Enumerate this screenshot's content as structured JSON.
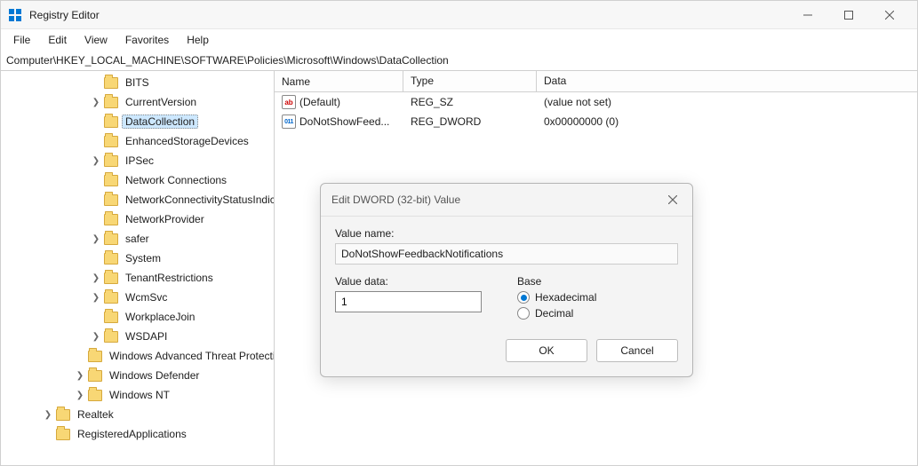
{
  "window": {
    "title": "Registry Editor"
  },
  "menu": {
    "file": "File",
    "edit": "Edit",
    "view": "View",
    "favorites": "Favorites",
    "help": "Help"
  },
  "address": "Computer\\HKEY_LOCAL_MACHINE\\SOFTWARE\\Policies\\Microsoft\\Windows\\DataCollection",
  "tree": [
    {
      "label": "BITS",
      "indent": 100,
      "twisty": ""
    },
    {
      "label": "CurrentVersion",
      "indent": 100,
      "twisty": ">"
    },
    {
      "label": "DataCollection",
      "indent": 100,
      "twisty": "",
      "selected": true
    },
    {
      "label": "EnhancedStorageDevices",
      "indent": 100,
      "twisty": ""
    },
    {
      "label": "IPSec",
      "indent": 100,
      "twisty": ">"
    },
    {
      "label": "Network Connections",
      "indent": 100,
      "twisty": ""
    },
    {
      "label": "NetworkConnectivityStatusIndicator",
      "indent": 100,
      "twisty": ""
    },
    {
      "label": "NetworkProvider",
      "indent": 100,
      "twisty": ""
    },
    {
      "label": "safer",
      "indent": 100,
      "twisty": ">"
    },
    {
      "label": "System",
      "indent": 100,
      "twisty": ""
    },
    {
      "label": "TenantRestrictions",
      "indent": 100,
      "twisty": ">"
    },
    {
      "label": "WcmSvc",
      "indent": 100,
      "twisty": ">"
    },
    {
      "label": "WorkplaceJoin",
      "indent": 100,
      "twisty": ""
    },
    {
      "label": "WSDAPI",
      "indent": 100,
      "twisty": ">"
    },
    {
      "label": "Windows Advanced Threat Protection",
      "indent": 82,
      "twisty": ""
    },
    {
      "label": "Windows Defender",
      "indent": 82,
      "twisty": ">"
    },
    {
      "label": "Windows NT",
      "indent": 82,
      "twisty": ">"
    },
    {
      "label": "Realtek",
      "indent": 46,
      "twisty": ">"
    },
    {
      "label": "RegisteredApplications",
      "indent": 46,
      "twisty": ""
    }
  ],
  "list": {
    "headers": {
      "name": "Name",
      "type": "Type",
      "data": "Data"
    },
    "rows": [
      {
        "icon": "sz",
        "name": "(Default)",
        "type": "REG_SZ",
        "data": "(value not set)"
      },
      {
        "icon": "dw",
        "name": "DoNotShowFeed...",
        "type": "REG_DWORD",
        "data": "0x00000000 (0)"
      }
    ]
  },
  "dialog": {
    "title": "Edit DWORD (32-bit) Value",
    "value_name_label": "Value name:",
    "value_name": "DoNotShowFeedbackNotifications",
    "value_data_label": "Value data:",
    "value_data": "1",
    "base_label": "Base",
    "hex_label": "Hexadecimal",
    "dec_label": "Decimal",
    "base_selected": "hex",
    "ok": "OK",
    "cancel": "Cancel"
  }
}
